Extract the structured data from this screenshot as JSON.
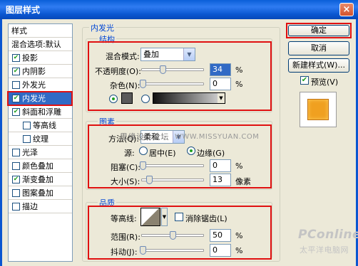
{
  "window": {
    "title": "图层样式",
    "close_glyph": "×"
  },
  "style_list": {
    "items": [
      {
        "label": "样式",
        "checkbox": false,
        "checked": false,
        "indent": false
      },
      {
        "label": "混合选项:默认",
        "checkbox": false,
        "checked": false,
        "indent": false
      },
      {
        "label": "投影",
        "checkbox": true,
        "checked": true,
        "indent": false
      },
      {
        "label": "内阴影",
        "checkbox": true,
        "checked": true,
        "indent": false
      },
      {
        "label": "外发光",
        "checkbox": true,
        "checked": false,
        "indent": false
      },
      {
        "label": "内发光",
        "checkbox": true,
        "checked": true,
        "indent": false,
        "selected": true
      },
      {
        "label": "斜面和浮雕",
        "checkbox": true,
        "checked": true,
        "indent": false
      },
      {
        "label": "等高线",
        "checkbox": true,
        "checked": false,
        "indent": true
      },
      {
        "label": "纹理",
        "checkbox": true,
        "checked": false,
        "indent": true
      },
      {
        "label": "光泽",
        "checkbox": true,
        "checked": false,
        "indent": false
      },
      {
        "label": "颜色叠加",
        "checkbox": true,
        "checked": false,
        "indent": false
      },
      {
        "label": "渐变叠加",
        "checkbox": true,
        "checked": true,
        "indent": false
      },
      {
        "label": "图案叠加",
        "checkbox": true,
        "checked": false,
        "indent": false
      },
      {
        "label": "描边",
        "checkbox": true,
        "checked": false,
        "indent": false
      }
    ]
  },
  "inner_glow": {
    "title": "内发光",
    "structure": {
      "title": "结构",
      "blend_mode_label": "混合模式:",
      "blend_mode_value": "叠加",
      "opacity_label": "不透明度(O):",
      "opacity_value": "34",
      "opacity_unit": "%",
      "noise_label": "杂色(N):",
      "noise_value": "0",
      "noise_unit": "%"
    },
    "elements": {
      "title": "图素",
      "method_label": "方法(Q):",
      "method_value": "柔和",
      "source_label": "源:",
      "source_center": "居中(E)",
      "source_edge": "边缘(G)",
      "choke_label": "阻塞(C):",
      "choke_value": "0",
      "choke_unit": "%",
      "size_label": "大小(S):",
      "size_value": "13",
      "size_unit": "像素"
    },
    "quality": {
      "title": "品质",
      "contour_label": "等高线:",
      "antialias_label": "消除锯齿(L)",
      "range_label": "范围(R):",
      "range_value": "50",
      "range_unit": "%",
      "jitter_label": "抖动(J):",
      "jitter_value": "0",
      "jitter_unit": "%"
    }
  },
  "buttons": {
    "ok": "确定",
    "cancel": "取消",
    "new_style": "新建样式(W)...",
    "preview": "预览(V)"
  },
  "watermarks": {
    "forum": "思缘设计论坛",
    "url": "WWW.MISSYUAN.COM",
    "brand": "PConline",
    "brand_sub": "太平洋电脑网"
  },
  "colors": {
    "title_bar": "#0a56d0",
    "selection": "#316ac5",
    "highlight_box": "#e01010",
    "preview_fill": "#f0a020"
  }
}
